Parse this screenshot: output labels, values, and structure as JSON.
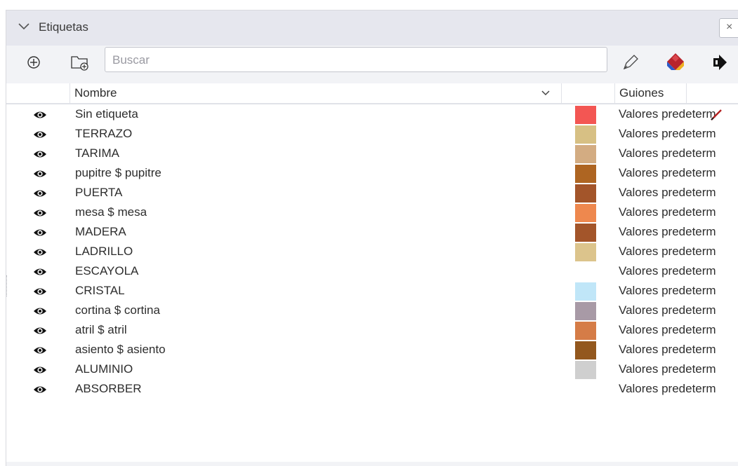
{
  "panel": {
    "title": "Etiquetas",
    "close_glyph": "×"
  },
  "toolbar": {
    "search_placeholder": "Buscar",
    "icons": [
      "add-circle-icon",
      "new-folder-icon",
      "pen-icon",
      "colorize-icon",
      "export-icon"
    ]
  },
  "table": {
    "col_name": "Nombre",
    "col_script": "Guiones",
    "rows": [
      {
        "name": "Sin etiqueta",
        "color": "#f35653",
        "script": "Valores predeterm"
      },
      {
        "name": "TERRAZO",
        "color": "#d7c084",
        "script": "Valores predeterm"
      },
      {
        "name": "TARIMA",
        "color": "#d3ac82",
        "script": "Valores predeterm"
      },
      {
        "name": "pupitre $ pupitre",
        "color": "#ae6522",
        "script": "Valores predeterm"
      },
      {
        "name": "PUERTA",
        "color": "#a3552a",
        "script": "Valores predeterm"
      },
      {
        "name": "mesa $ mesa",
        "color": "#ee884e",
        "script": "Valores predeterm"
      },
      {
        "name": "MADERA",
        "color": "#a3552a",
        "script": "Valores predeterm"
      },
      {
        "name": "LADRILLO",
        "color": "#dcc48c",
        "script": "Valores predeterm"
      },
      {
        "name": "ESCAYOLA",
        "color": "#ffffff",
        "script": "Valores predeterm"
      },
      {
        "name": "CRISTAL",
        "color": "#c0e6f8",
        "script": "Valores predeterm"
      },
      {
        "name": "cortina $ cortina",
        "color": "#a89aa6",
        "script": "Valores predeterm"
      },
      {
        "name": "atril $ atril",
        "color": "#d57c47",
        "script": "Valores predeterm"
      },
      {
        "name": "asiento $ asiento",
        "color": "#93581e",
        "script": "Valores predeterm"
      },
      {
        "name": "ALUMINIO",
        "color": "#cfcfcf",
        "script": "Valores predeterm"
      },
      {
        "name": "ABSORBER",
        "color": "#ffffff",
        "script": "Valores predeterm"
      }
    ]
  }
}
